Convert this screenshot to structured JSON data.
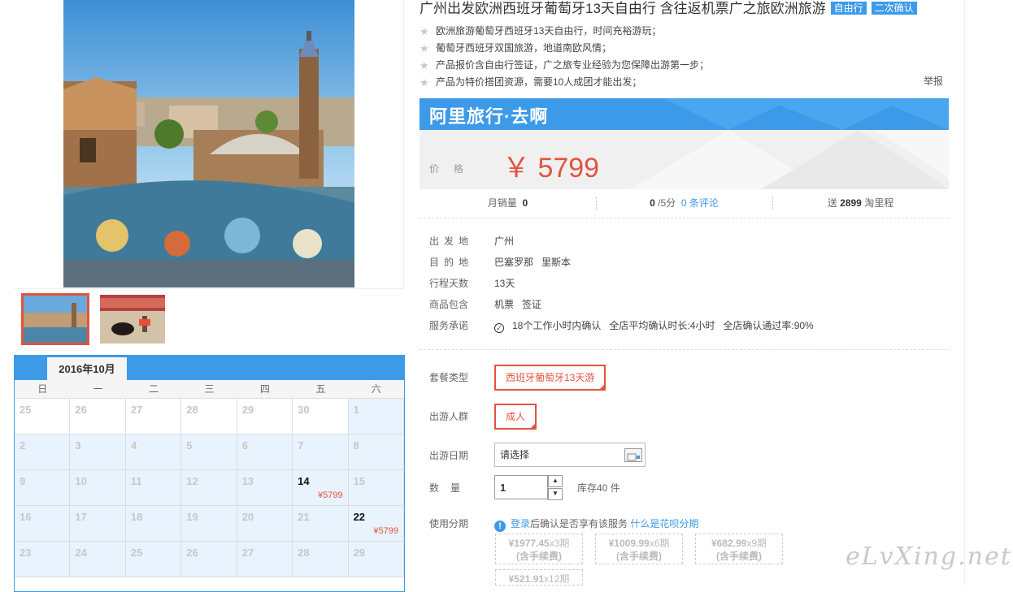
{
  "product": {
    "title": "广州出发欧洲西班牙葡萄牙13天自由行 含往返机票广之旅欧洲旅游",
    "tags": [
      "自由行",
      "二次确认"
    ],
    "features": [
      "欧洲旅游葡萄牙西班牙13天自由行，时间充裕游玩；",
      "葡萄牙西班牙双国旅游，地道南欧风情；",
      "产品报价含自由行签证，广之旅专业经验为您保障出游第一步；",
      "产品为特价搭团资源，需要10人成团才能出发；"
    ],
    "report_label": "举报"
  },
  "banner": {
    "brand": "阿里旅行·去啊",
    "price_label": "价格",
    "price": "￥ 5799"
  },
  "stats": {
    "monthly_sales_label": "月销量",
    "monthly_sales": "0",
    "rating": "0",
    "rating_suffix": "/5分",
    "reviews": "0 条评论",
    "points_prefix": "送",
    "points": "2899",
    "points_suffix": "淘里程"
  },
  "info": {
    "departure_label": "出发地",
    "departure": "广州",
    "destination_label": "目的地",
    "destinations": [
      "巴塞罗那",
      "里斯本"
    ],
    "days_label": "行程天数",
    "days": "13天",
    "includes_label": "商品包含",
    "includes": [
      "机票",
      "签证"
    ],
    "promise_label": "服务承诺",
    "promises": [
      "18个工作小时内确认",
      "全店平均确认时长:4小时",
      "全店确认通过率:90%"
    ]
  },
  "options": {
    "package_label": "套餐类型",
    "package_value": "西班牙葡萄牙13天游",
    "traveler_label": "出游人群",
    "traveler_value": "成人",
    "date_label": "出游日期",
    "date_placeholder": "请选择",
    "qty_label": "数量",
    "qty_value": "1",
    "stock": "库存40 件",
    "installment_label": "使用分期",
    "installment_login": "登录",
    "installment_note": "后确认是否享有该服务",
    "installment_link": "什么是花呗分期",
    "installments": [
      {
        "amount": "¥1977.45",
        "period": "x3期",
        "fee": "(含手续费)"
      },
      {
        "amount": "¥1009.99",
        "period": "x6期",
        "fee": "(含手续费)"
      },
      {
        "amount": "¥682.99",
        "period": "x9期",
        "fee": "(含手续费)"
      },
      {
        "amount": "¥521.91",
        "period": "x12期",
        "fee": ""
      }
    ]
  },
  "calendar": {
    "month": "2016年10月",
    "weekdays": [
      "日",
      "一",
      "二",
      "三",
      "四",
      "五",
      "六"
    ],
    "price_tag": "¥5799",
    "days": [
      "25",
      "26",
      "27",
      "28",
      "29",
      "30",
      "1",
      "2",
      "3",
      "4",
      "5",
      "6",
      "7",
      "8",
      "9",
      "10",
      "11",
      "12",
      "13",
      "14",
      "15",
      "16",
      "17",
      "18",
      "19",
      "20",
      "21",
      "22",
      "23",
      "24",
      "25",
      "26",
      "27",
      "28",
      "29"
    ],
    "available_days": [
      "14",
      "22"
    ]
  },
  "watermark": "eLvXing.net"
}
